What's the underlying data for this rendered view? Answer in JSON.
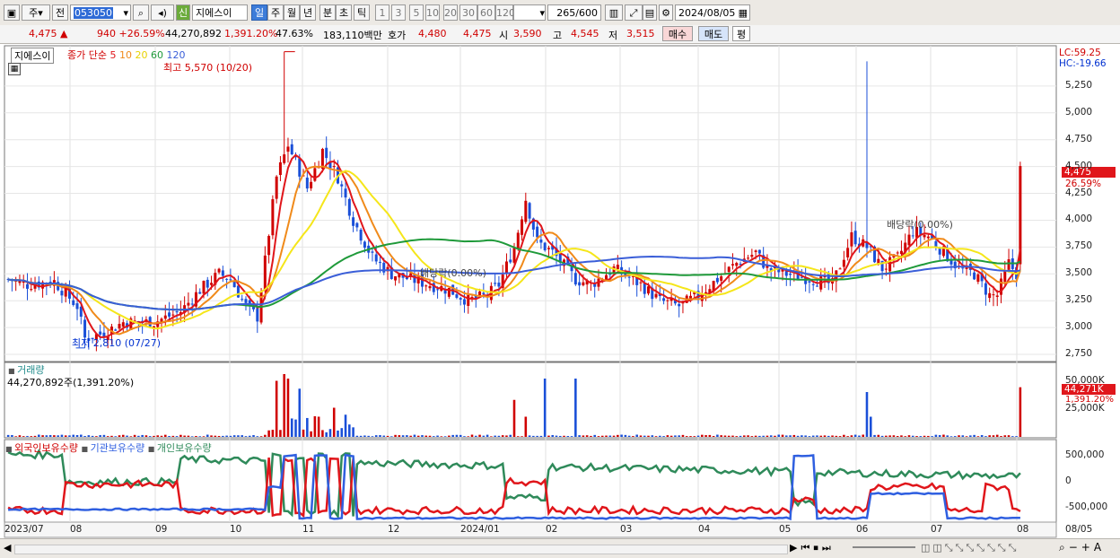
{
  "toolbar": {
    "period_type": "주",
    "prev_label": "전",
    "stock_code": "053050",
    "new_badge": "신",
    "stock_name": "지에스이",
    "periods": [
      "일",
      "주",
      "월",
      "년",
      "분",
      "초",
      "틱"
    ],
    "active_period": "일",
    "intervals": [
      "1",
      "3",
      "5",
      "10",
      "20",
      "30",
      "60",
      "120"
    ],
    "count_value": "265",
    "count_total": "/600",
    "date": "2024/08/05"
  },
  "info": {
    "price": "4,475 ▲",
    "change": "940 +26.59%",
    "volume": "44,270,892",
    "volume_pct": "1,391.20%",
    "turnover": "47.63%",
    "amount": "183,110백만",
    "hoga_label": "호가",
    "hoga_bid": "4,480",
    "hoga_ask": "4,475",
    "open_label": "시",
    "open": "3,590",
    "high_label": "고",
    "high": "4,545",
    "low_label": "저",
    "low": "3,515",
    "buy_label": "매수",
    "sell_label": "매도",
    "eval_label": "평"
  },
  "panel": {
    "stock_tag": "지에스이",
    "ma_legend_prefix": "종가 단순",
    "ma_periods": [
      "5",
      "10",
      "20",
      "60",
      "120"
    ],
    "high_note": "최고 5,570 (10/20)",
    "low_note": "최저 2,810 (07/27)",
    "dividend1": "배당락(0.00%)",
    "dividend2": "배당락(0.00%)",
    "lc": "LC:59.25",
    "hc": "HC:-19.66",
    "price_tag": "4,475",
    "pct_tag": "26.59%"
  },
  "volume_panel": {
    "title": "거래량",
    "summary": "44,270,892주(1,391.20%)",
    "tag": "44,271K",
    "tag_pct": "1,391.20%"
  },
  "holders_panel": {
    "legend": [
      "외국인보유수량",
      "기관보유수량",
      "개인보유수량"
    ]
  },
  "axes": {
    "price_ticks": [
      "5,250",
      "5,000",
      "4,750",
      "4,500",
      "4,250",
      "4,000",
      "3,750",
      "3,500",
      "3,250",
      "3,000",
      "2,750"
    ],
    "volume_ticks": [
      "50,000K",
      "25,000K"
    ],
    "holder_ticks": [
      "500,000",
      "0",
      "-500,000"
    ],
    "x_ticks": [
      "2023/07",
      "08",
      "09",
      "10",
      "11",
      "12",
      "2024/01",
      "02",
      "03",
      "04",
      "05",
      "06",
      "07",
      "08",
      "08/05"
    ]
  },
  "colors": {
    "up": "#d00000",
    "down": "#1a4fd8",
    "ma5": "#e0161b",
    "ma10": "#f08a1a",
    "ma20": "#f5e61a",
    "ma60": "#1f9a3a",
    "ma120": "#3a5ed8",
    "foreign": "#e0161b",
    "institution": "#2f5fe0",
    "individual": "#2f8a5a"
  },
  "chart_data": {
    "type": "line",
    "title": "지에스이 (053050)",
    "x": [
      "2023/07",
      "2023/08",
      "2023/09",
      "2023/10",
      "2023/11",
      "2023/12",
      "2024/01",
      "2024/02",
      "2024/03",
      "2024/04",
      "2024/05",
      "2024/06",
      "2024/07",
      "2024/08/05"
    ],
    "ylim": [
      2700,
      5550
    ],
    "series": [
      {
        "name": "종가",
        "values": [
          3450,
          2950,
          3350,
          4650,
          3700,
          3350,
          3450,
          3650,
          3250,
          3700,
          3550,
          4150,
          3550,
          4475
        ]
      },
      {
        "name": "거래량",
        "values": [
          800,
          1200,
          3000,
          20000,
          12000,
          1800,
          23000,
          2500,
          1500,
          4000,
          3000,
          30000,
          2500,
          44271
        ]
      }
    ],
    "annotations": [
      "최고 5,570 (10/20)",
      "최저 2,810 (07/27)"
    ]
  }
}
